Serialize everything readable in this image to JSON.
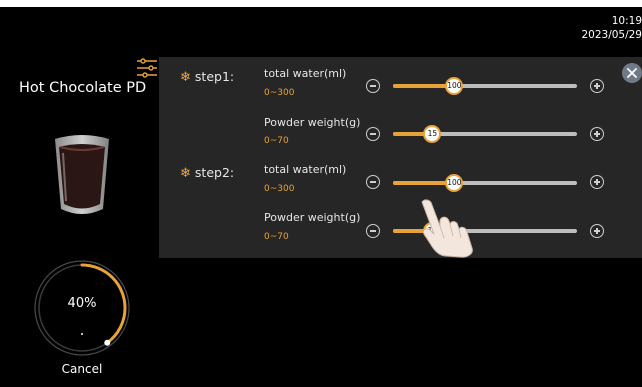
{
  "header": {
    "time": "10:19",
    "date": "2023/05/29"
  },
  "product": {
    "name": "Hot Chocolate  PD"
  },
  "progress": {
    "percent": 40,
    "label": "40%"
  },
  "cancel_label": "Cancel",
  "colors": {
    "accent": "#e7a23a",
    "panel_bg": "#262626",
    "track": "#bdbdbd",
    "close_button": "#6f7a88"
  },
  "icons": {
    "settings": "sliders-icon",
    "step": "snowflake-icon",
    "minus": "minus-circle-icon",
    "plus": "plus-circle-icon",
    "close": "close-icon"
  },
  "steps": [
    {
      "label": "step1:",
      "params": [
        {
          "name": "total water(ml)",
          "range": "0~300",
          "value": "100",
          "fraction": 0.333
        },
        {
          "name": "Powder weight(g)",
          "range": "0~70",
          "value": "15",
          "fraction": 0.214
        }
      ]
    },
    {
      "label": "step2:",
      "params": [
        {
          "name": "total water(ml)",
          "range": "0~300",
          "value": "100",
          "fraction": 0.333
        },
        {
          "name": "Powder weight(g)",
          "range": "0~70",
          "value": "15",
          "fraction": 0.214
        }
      ]
    }
  ]
}
